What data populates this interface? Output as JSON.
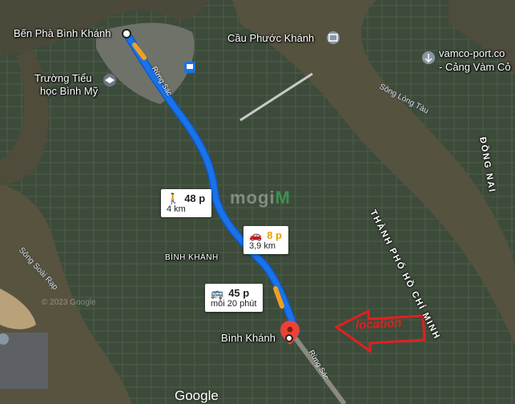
{
  "map": {
    "places": {
      "ben_pha": "Bến Phà Bình Khánh",
      "cau": "Cầu Phước Khánh",
      "school_line1": "Trường Tiểu",
      "school_line2": "học Bình Mỹ",
      "vamco_line1": "vamco-port.co",
      "vamco_line2": "- Cảng Vàm Cỏ",
      "binh_khanh_area": "BÌNH KHÁNH",
      "binh_khanh_dest": "Bình Khánh"
    },
    "rivers": {
      "long_tau": "Sông Lòng Tàu",
      "soai_rap": "Sông Soài Rạp"
    },
    "regions": {
      "hcm": "THÀNH PHỐ HỒ CHÍ MINH",
      "dong_nai": "ĐỒNG NAI"
    },
    "roads": {
      "rung_sac_top": "Rừng Sác",
      "rung_sac_bottom": "Rừng Sác"
    },
    "routes": [
      {
        "mode": "walking",
        "icon": "walk-icon",
        "duration": "48 p",
        "detail": "4 km"
      },
      {
        "mode": "driving",
        "icon": "car-icon",
        "duration": "8 p",
        "detail": "3,9 km"
      },
      {
        "mode": "transit",
        "icon": "bus-icon",
        "duration": "45 p",
        "detail": "mỗi 20 phút"
      }
    ],
    "annotation": "location",
    "watermark": {
      "part1": "mogi",
      "part2": "M"
    },
    "copyright": "© 2023 Google",
    "brand": "Google",
    "colors": {
      "route": "#1a73e8",
      "traffic": "#f0a020",
      "pin": "#ea4335",
      "annotation": "#e02020"
    }
  }
}
